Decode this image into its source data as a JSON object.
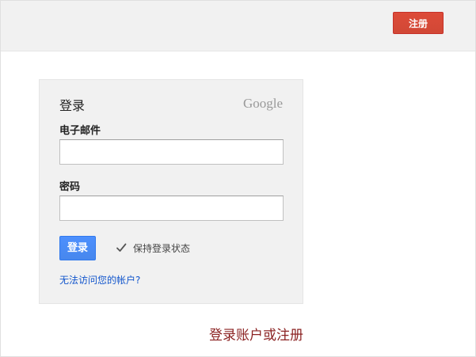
{
  "header": {
    "signup_label": "注册"
  },
  "login": {
    "title": "登录",
    "logo_text": "Google",
    "email_label": "电子邮件",
    "email_value": "",
    "password_label": "密码",
    "password_value": "",
    "signin_label": "登录",
    "remember_label": "保持登录状态",
    "remember_checked": true,
    "help_link": "无法访问您的帐户?"
  },
  "footer": {
    "promo_link": "登录账户或注册"
  },
  "colors": {
    "signup_button": "#d14836",
    "signin_button": "#4d90fe",
    "link": "#1155cc",
    "promo_link": "#8b2222",
    "card_background": "#f1f1f1"
  }
}
